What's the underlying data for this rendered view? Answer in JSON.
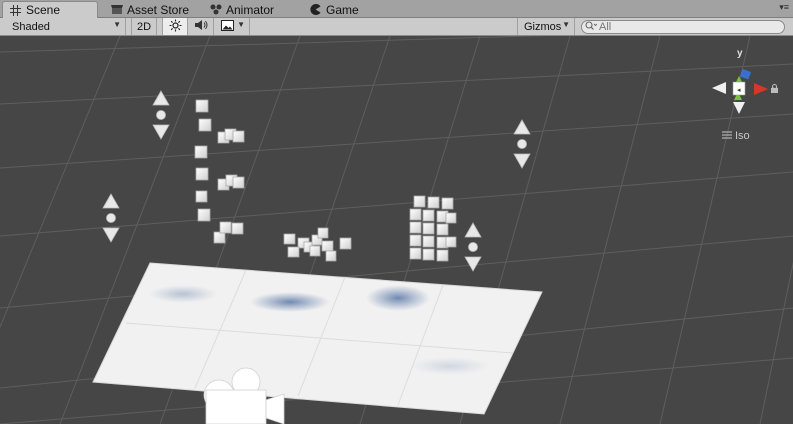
{
  "tabs": [
    {
      "label": "Scene",
      "icon": "grid-icon",
      "active": true
    },
    {
      "label": "Asset Store",
      "icon": "store-icon",
      "active": false
    },
    {
      "label": "Animator",
      "icon": "animator-icon",
      "active": false
    },
    {
      "label": "Game",
      "icon": "pacman-icon",
      "active": false
    }
  ],
  "toolbar": {
    "draw_mode": "Shaded",
    "mode_2d": "2D",
    "lighting_icon": "sun-icon",
    "audio_icon": "speaker-icon",
    "effects_icon": "image-icon",
    "gizmos": "Gizmos",
    "search_placeholder": "All"
  },
  "scene": {
    "gizmo_axes": {
      "y": "y",
      "x": "x"
    },
    "projection": "Iso"
  },
  "colors": {
    "tab_bg": "#a2a2a2",
    "toolbar_bg": "#cbcbcb",
    "scene_bg": "#464646",
    "grid": "#5a5a5a",
    "x_axis": "#d8362a",
    "y_axis": "#7ac23c",
    "z_axis": "#3a6fd0"
  }
}
